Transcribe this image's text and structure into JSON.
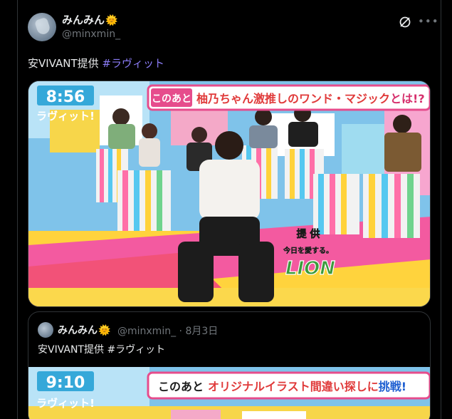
{
  "post": {
    "display_name": "みんみん",
    "name_emoji": "🌞",
    "handle": "@minxmin_",
    "text_plain": "安VIVANT提供 ",
    "hashtag": "#ラヴィット",
    "media": {
      "clock": "8:56",
      "show_logo": "ラヴィット!",
      "banner_prefix": "このあと",
      "banner_main": "柚乃ちゃん激推しのワンド・マジック",
      "banner_suffix": "とは!?",
      "sponsor_label": "提 供",
      "sponsor_tagline": "今日を愛する。",
      "sponsor_logo": "LION"
    }
  },
  "quote": {
    "display_name": "みんみん",
    "name_emoji": "🌞",
    "handle": "@minxmin_",
    "separator": "·",
    "date": "8月3日",
    "text": "安VIVANT提供 #ラヴィット",
    "media": {
      "clock": "9:10",
      "show_logo": "ラヴィット!",
      "banner_prefix": "このあと",
      "banner_main": "オリジナルイラスト間違い探しに",
      "banner_suffix": "挑戦!"
    }
  },
  "colors": {
    "background": "#000000",
    "text": "#e7e9ea",
    "muted": "#71767b",
    "hashtag": "#8b7cf6",
    "border": "#2f3336"
  },
  "icons": [
    "grok-icon",
    "more-icon",
    "avatar"
  ]
}
